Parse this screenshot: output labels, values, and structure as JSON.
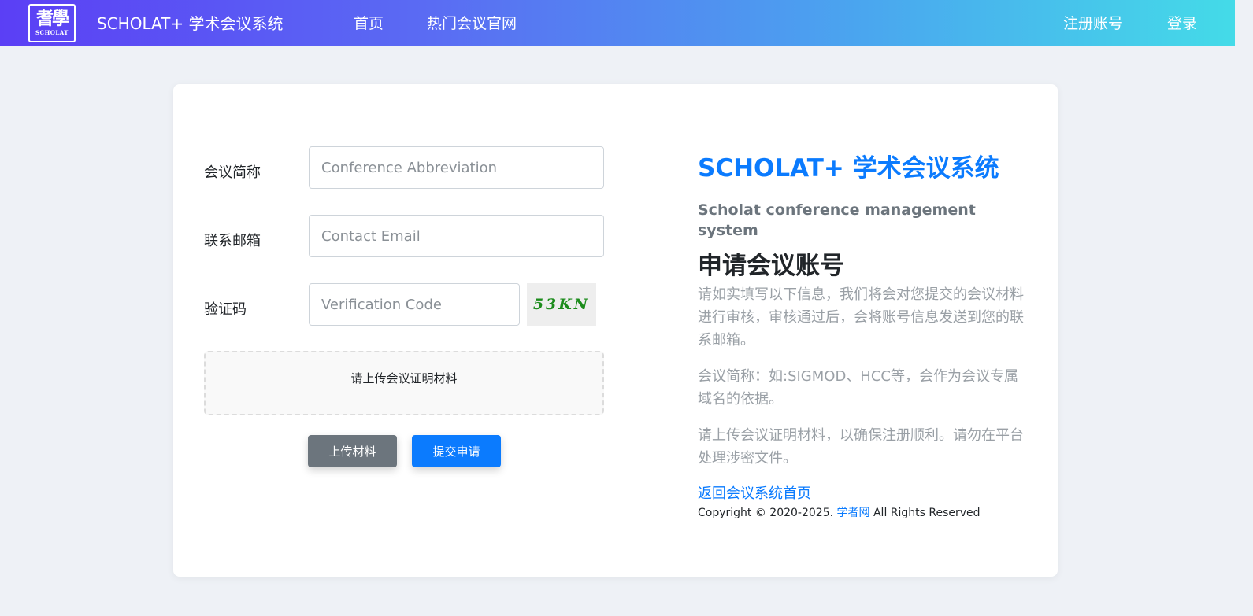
{
  "nav": {
    "logo_glyph": "耆學",
    "logo_sub": "SCHOLAT",
    "brand": "SCHOLAT+ 学术会议系统",
    "home": "首页",
    "hot": "热门会议官网",
    "register": "注册账号",
    "login": "登录"
  },
  "form": {
    "abbr_label": "会议简称",
    "abbr_placeholder": "Conference Abbreviation",
    "email_label": "联系邮箱",
    "email_placeholder": "Contact Email",
    "code_label": "验证码",
    "code_placeholder": "Verification Code",
    "captcha": "53KN",
    "upload_hint": "请上传会议证明材料",
    "upload_button": "上传材料",
    "submit_button": "提交申请"
  },
  "info": {
    "title": "SCHOLAT+ 学术会议系统",
    "subtitle": "Scholat conference management system",
    "heading": "申请会议账号",
    "p1": "请如实填写以下信息，我们将会对您提交的会议材料进行审核，审核通过后，会将账号信息发送到您的联系邮箱。",
    "p2": "会议简称：如:SIGMOD、HCC等，会作为会议专属域名的依据。",
    "p3": "请上传会议证明材料，以确保注册顺利。请勿在平台处理涉密文件。",
    "back_link": "返回会议系统首页",
    "copyright_prefix": "Copyright © 2020-2025. ",
    "copyright_site": "学者网",
    "copyright_suffix": " All Rights Reserved"
  },
  "colors": {
    "primary": "#0b7bfe",
    "secondary": "#6c757d",
    "captcha_text": "#1c8c1c",
    "nav_gradient_start": "#5b3ff5",
    "nav_gradient_end": "#44dbe8"
  }
}
